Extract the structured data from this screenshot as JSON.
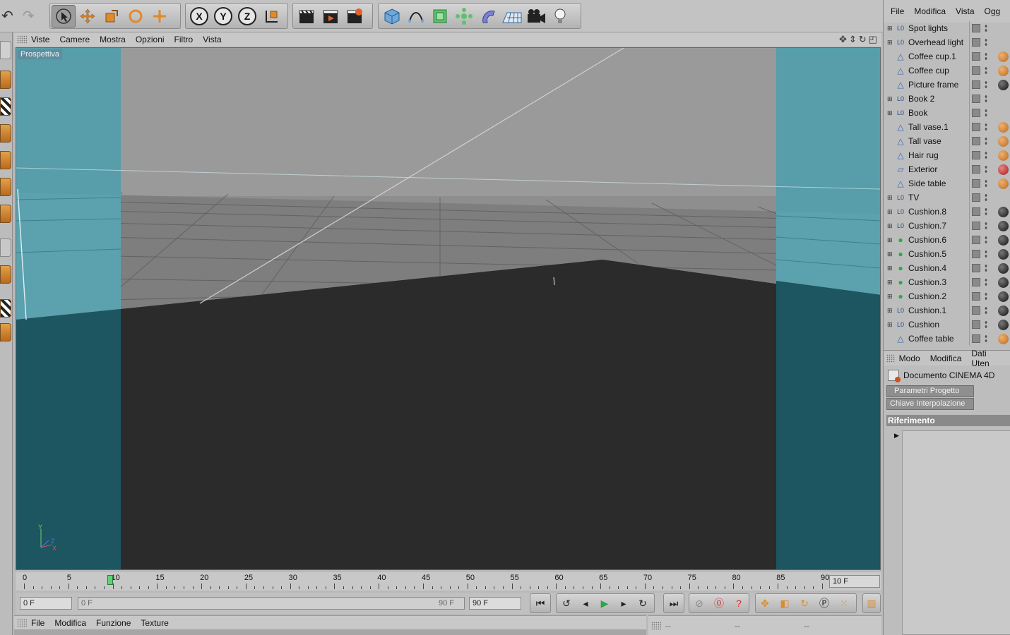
{
  "viewport_menu": {
    "items": [
      "Viste",
      "Camere",
      "Mostra",
      "Opzioni",
      "Filtro",
      "Vista"
    ],
    "label": "Prospettiva"
  },
  "toolbar": {
    "axis_x": "X",
    "axis_y": "Y",
    "axis_z": "Z"
  },
  "timeline": {
    "ticks": [
      "0",
      "5",
      "10",
      "15",
      "20",
      "25",
      "30",
      "35",
      "40",
      "45",
      "50",
      "55",
      "60",
      "65",
      "70",
      "75",
      "80",
      "85",
      "90"
    ],
    "current_frame": "10 F",
    "playhead_frame": 10,
    "max_frame": 90
  },
  "transport": {
    "start": "0 F",
    "range_start": "0 F",
    "range_end": "90 F",
    "end": "90 F"
  },
  "material_menu": {
    "items": [
      "File",
      "Modifica",
      "Funzione",
      "Texture"
    ]
  },
  "coord_menu": {
    "items": [
      "--",
      "--",
      "--"
    ]
  },
  "object_manager": {
    "menu": [
      "File",
      "Modifica",
      "Vista",
      "Ogg"
    ],
    "objects": [
      {
        "name": "Spot lights",
        "type": "null",
        "expand": true,
        "tag": ""
      },
      {
        "name": "Overhead light",
        "type": "null",
        "expand": true,
        "tag": ""
      },
      {
        "name": "Coffee cup.1",
        "type": "poly",
        "expand": false,
        "tag": "mat-orange"
      },
      {
        "name": "Coffee cup",
        "type": "poly",
        "expand": false,
        "tag": "mat-orange"
      },
      {
        "name": "Picture frame",
        "type": "poly",
        "expand": false,
        "tag": "mat-dark"
      },
      {
        "name": "Book 2",
        "type": "null",
        "expand": true,
        "tag": ""
      },
      {
        "name": "Book",
        "type": "null",
        "expand": true,
        "tag": ""
      },
      {
        "name": "Tall vase.1",
        "type": "poly",
        "expand": false,
        "tag": "mat-orange"
      },
      {
        "name": "Tall vase",
        "type": "poly",
        "expand": false,
        "tag": "mat-orange"
      },
      {
        "name": "Hair rug",
        "type": "poly",
        "expand": false,
        "tag": "mat-orange"
      },
      {
        "name": "Exterior",
        "type": "plane",
        "expand": false,
        "tag": "mat-red"
      },
      {
        "name": "Side table",
        "type": "poly",
        "expand": false,
        "tag": "mat-orange"
      },
      {
        "name": "TV",
        "type": "null",
        "expand": true,
        "tag": ""
      },
      {
        "name": "Cushion.8",
        "type": "null",
        "expand": true,
        "tag": "mat-dark"
      },
      {
        "name": "Cushion.7",
        "type": "null",
        "expand": true,
        "tag": "mat-dark"
      },
      {
        "name": "Cushion.6",
        "type": "gen",
        "expand": true,
        "tag": "mat-dark"
      },
      {
        "name": "Cushion.5",
        "type": "gen",
        "expand": true,
        "tag": "mat-dark"
      },
      {
        "name": "Cushion.4",
        "type": "gen",
        "expand": true,
        "tag": "mat-dark"
      },
      {
        "name": "Cushion.3",
        "type": "gen",
        "expand": true,
        "tag": "mat-dark"
      },
      {
        "name": "Cushion.2",
        "type": "gen",
        "expand": true,
        "tag": "mat-dark"
      },
      {
        "name": "Cushion.1",
        "type": "null",
        "expand": true,
        "tag": "mat-dark"
      },
      {
        "name": "Cushion",
        "type": "null",
        "expand": true,
        "tag": "mat-dark"
      },
      {
        "name": "Coffee table",
        "type": "poly",
        "expand": false,
        "tag": "mat-orange"
      }
    ]
  },
  "attribute_manager": {
    "menu": [
      "Modo",
      "Modifica",
      "Dati Uten"
    ],
    "document": "Documento CINEMA 4D",
    "tabs": [
      "Parametri Progetto",
      "Chiave Interpolazione"
    ],
    "section": "Riferimento"
  },
  "colors": {
    "viewport_bg": "#2b2b2b",
    "cyan_wall": "#5aa3b1",
    "playhead": "#5fd07a",
    "accent_orange": "#e08a2a"
  }
}
